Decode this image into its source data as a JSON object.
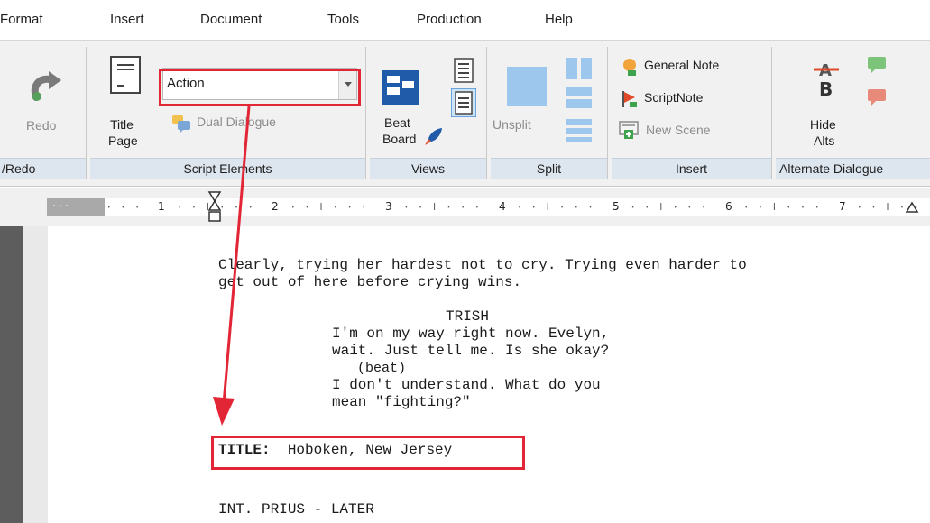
{
  "menu": [
    "Format",
    "Insert",
    "Document",
    "Tools",
    "Production",
    "Help"
  ],
  "ribbon": {
    "redo_group": {
      "redo_label": "Redo",
      "group_label": "/Redo"
    },
    "script_elements": {
      "title_page_label_1": "Title",
      "title_page_label_2": "Page",
      "element_dropdown_value": "Action",
      "dual_dialogue_label": "Dual Dialogue",
      "group_label": "Script Elements"
    },
    "views": {
      "beat_board_label_1": "Beat",
      "beat_board_label_2": "Board",
      "group_label": "Views"
    },
    "split": {
      "unsplit_label": "Unsplit",
      "group_label": "Split"
    },
    "insert": {
      "general_note_label": "General Note",
      "scriptnote_label": "ScriptNote",
      "new_scene_label": "New Scene",
      "group_label": "Insert"
    },
    "alternate_dialogue": {
      "hide_alts_label_1": "Hide",
      "hide_alts_label_2": "Alts",
      "group_label": "Alternate Dialogue"
    }
  },
  "ruler": {
    "numbers": [
      "1",
      "2",
      "3",
      "4",
      "5",
      "6",
      "7"
    ]
  },
  "script": {
    "action_1": "Clearly, trying her hardest not to cry. Trying even harder to",
    "action_2": "get out of here before crying wins.",
    "character": "TRISH",
    "dialogue_1": "I'm on my way right now. Evelyn,",
    "dialogue_2": "wait. Just tell me. Is she okay?",
    "parenthetical": "(beat)",
    "dialogue_3": "I don't understand. What do you",
    "dialogue_4": "mean \"fighting?\"",
    "title_prefix": "TITLE:",
    "title_text": "Hoboken, New Jersey",
    "scene_heading": "INT. PRIUS - LATER"
  },
  "colors": {
    "callout": "#e32636",
    "group_label_bg": "#dde5ef",
    "ribbon_bg": "#f1f1f1"
  }
}
